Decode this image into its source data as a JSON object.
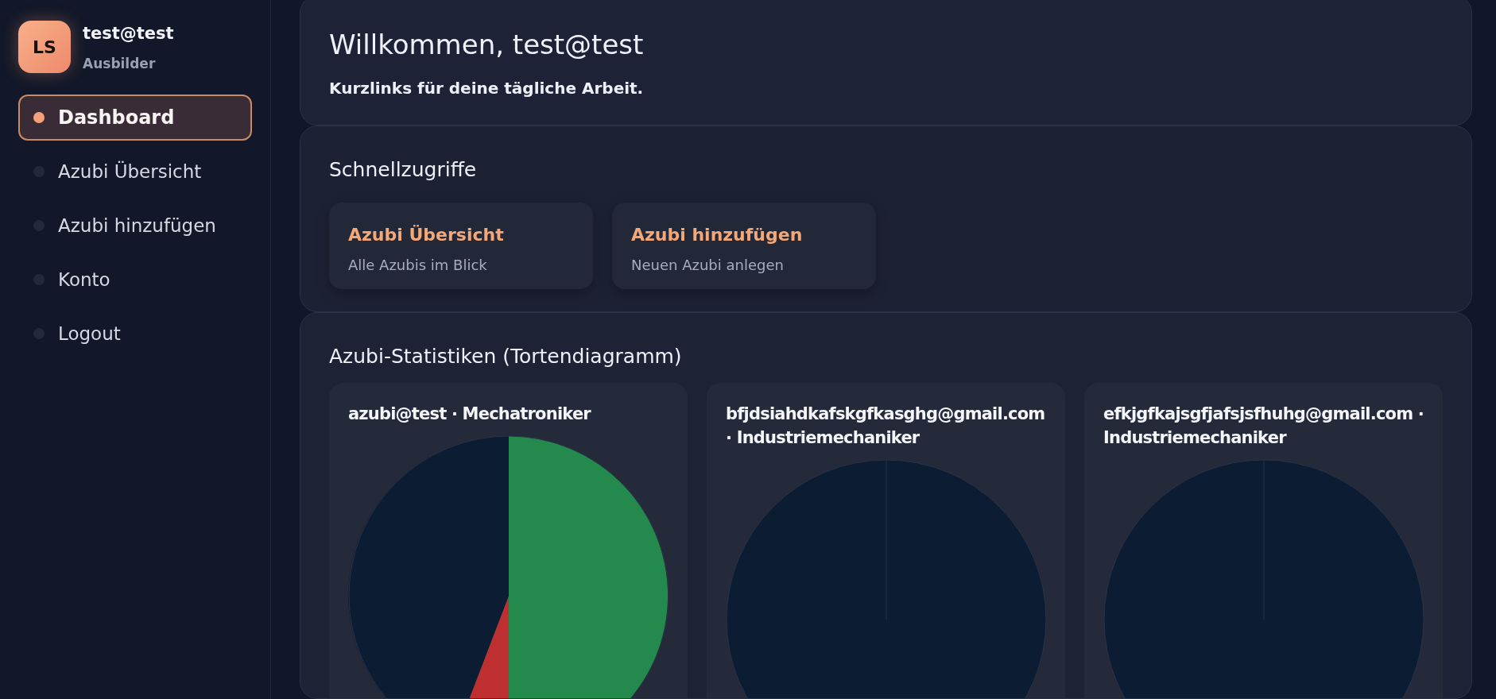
{
  "user": {
    "initials": "LS",
    "name": "test@test",
    "role": "Ausbilder"
  },
  "nav": [
    {
      "label": "Dashboard",
      "selected": true
    },
    {
      "label": "Azubi Übersicht",
      "selected": false
    },
    {
      "label": "Azubi hinzufügen",
      "selected": false
    },
    {
      "label": "Konto",
      "selected": false
    },
    {
      "label": "Logout",
      "selected": false
    }
  ],
  "welcome": {
    "title": "Willkommen, test@test",
    "subtitle": "Kurzlinks für deine tägliche Arbeit."
  },
  "quick_access": {
    "title": "Schnellzugriffe",
    "links": [
      {
        "title": "Azubi Übersicht",
        "description": "Alle Azubis im Blick"
      },
      {
        "title": "Azubi hinzufügen",
        "description": "Neuen Azubi anlegen"
      }
    ]
  },
  "statistics": {
    "title": "Azubi-Statistiken (Tortendiagramm)",
    "cards": [
      {
        "title": "azubi@test · Mechatroniker",
        "kind": "mixed"
      },
      {
        "title": "bfjdsiahdkafskgfkasghg@gmail.com · Industriemechaniker",
        "kind": "empty"
      },
      {
        "title": "efkjgfkajsgfjafsjsfhuhg@gmail.com · Industriemechaniker",
        "kind": "empty"
      }
    ]
  }
}
